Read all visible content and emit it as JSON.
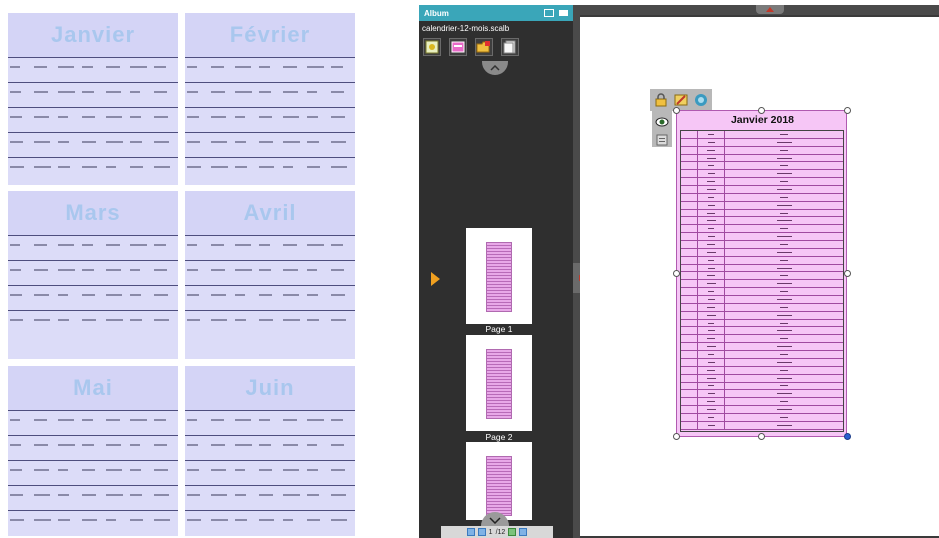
{
  "left_preview": {
    "months": [
      {
        "name": "Janvier"
      },
      {
        "name": "Février"
      },
      {
        "name": "Mars"
      },
      {
        "name": "Avril"
      },
      {
        "name": "Mai"
      },
      {
        "name": "Juin"
      }
    ]
  },
  "album": {
    "title": "Album",
    "file_name": "calendrier-12-mois.scalb",
    "pages": [
      {
        "label": "Page 1"
      },
      {
        "label": "Page 2"
      },
      {
        "label": ""
      }
    ],
    "pager": {
      "current": "1",
      "total": "/12"
    }
  },
  "editor": {
    "page_title": "Janvier 2018"
  },
  "colors": {
    "album_header": "#3aa6b9",
    "album_bg": "#2f2f2f",
    "month_bg": "#dcdcf8",
    "month_title": "#a9c7ee",
    "page_pink": "#f6c6f6",
    "arrow_orange": "#f0a020"
  },
  "icons": {
    "album_header": [
      "view-toggle-icon",
      "panel-icon"
    ],
    "album_tools": [
      "add-page-icon",
      "pink-template-icon",
      "folder-icon",
      "document-icon"
    ],
    "floating_tools": [
      "lock-icon",
      "edit-icon",
      "refresh-icon",
      "eye-icon",
      "properties-icon"
    ],
    "pager": [
      "first-page-icon",
      "prev-page-icon",
      "next-page-icon",
      "last-page-icon"
    ]
  }
}
